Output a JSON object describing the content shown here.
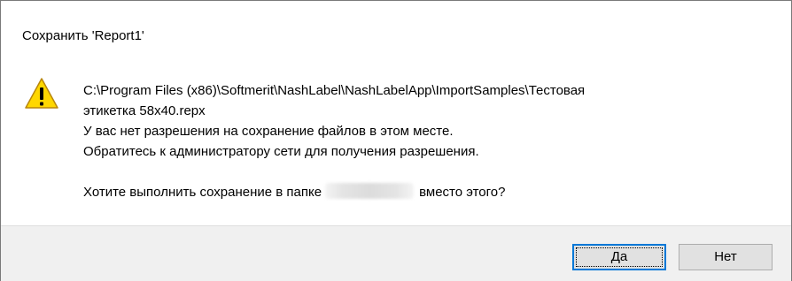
{
  "dialog": {
    "title": "Сохранить 'Report1'",
    "icon": "warning-icon",
    "message_lines": [
      "C:\\Program Files (x86)\\Softmerit\\NashLabel\\NashLabelApp\\ImportSamples\\Тестовая",
      "этикетка 58x40.repx",
      "У вас нет разрешения на сохранение файлов в этом месте.",
      "Обратитесь к администратору сети для получения разрешения."
    ],
    "question_before": "Хотите выполнить сохранение в папке",
    "question_after": "вместо этого?"
  },
  "buttons": {
    "yes_label": "Да",
    "no_label": "Нет"
  },
  "colors": {
    "warning_fill": "#ffd700",
    "focus_border": "#0078d7",
    "footer_bg": "#f0f0f0"
  }
}
